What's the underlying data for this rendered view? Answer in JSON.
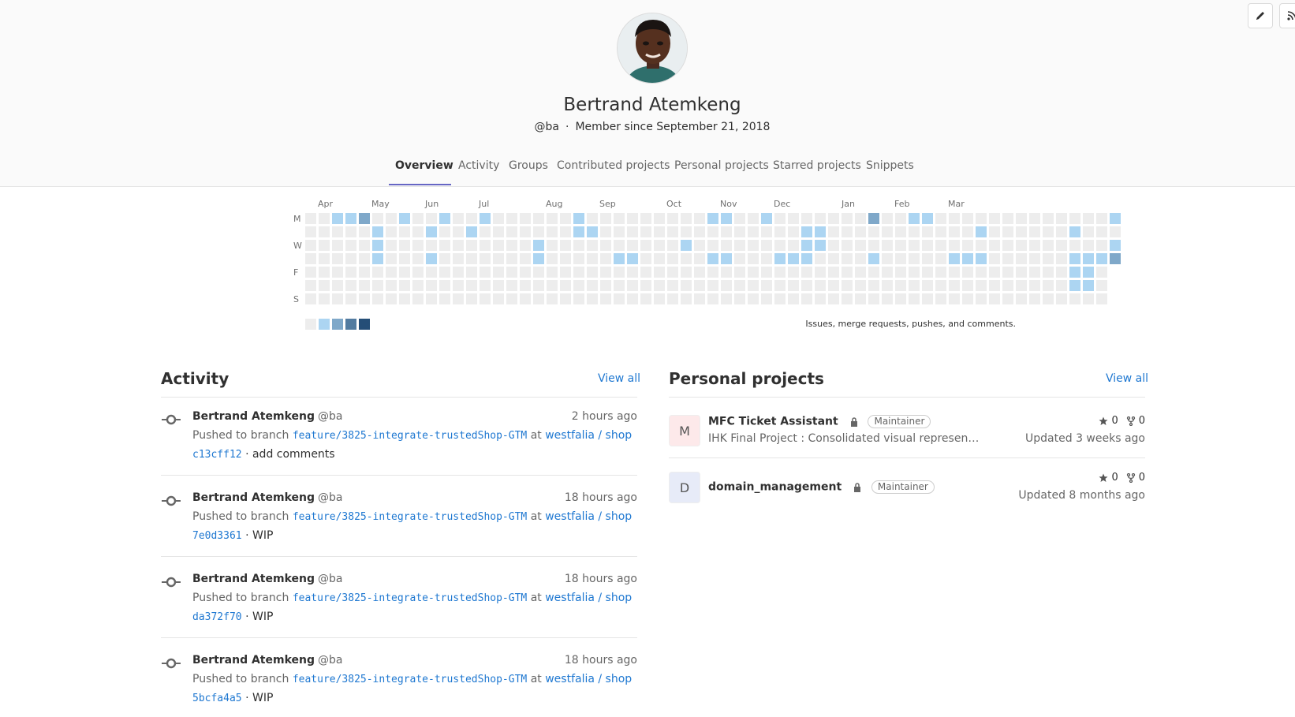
{
  "header": {
    "edit_icon": "pencil-icon",
    "rss_icon": "rss-icon",
    "name": "Bertrand Atemkeng",
    "handle": "@ba",
    "separator": "·",
    "member_since": "Member since September 21, 2018"
  },
  "tabs": [
    {
      "label": "Overview",
      "active": true
    },
    {
      "label": "Activity",
      "active": false
    },
    {
      "label": "Groups",
      "active": false
    },
    {
      "label": "Contributed projects",
      "active": false
    },
    {
      "label": "Personal projects",
      "active": false
    },
    {
      "label": "Starred projects",
      "active": false
    },
    {
      "label": "Snippets",
      "active": false
    }
  ],
  "calendar": {
    "months": [
      "Apr",
      "May",
      "Jun",
      "Jul",
      "Aug",
      "Sep",
      "Oct",
      "Nov",
      "Dec",
      "Jan",
      "Feb",
      "Mar"
    ],
    "days": [
      "M",
      "W",
      "F",
      "S"
    ],
    "caption": "Issues, merge requests, pushes, and comments.",
    "colors": [
      "#ededed",
      "#acd5f2",
      "#7fa8c9",
      "#527ba0",
      "#254e77"
    ],
    "levels": [
      "0011200100100100000010000000001100100000002001100000000000001",
      "0000010001001000000011000000000000000110000000000010000001000",
      "0000010000000000010000000000100000000110000000000000000000001",
      "0000010001000000010000011000001100011100001000001110000001112",
      "0000000000000000000000000000000000000000000000000000000001102",
      "0000000000000000000000000000000000000000000000000000000001102",
      "0000000000000000000000000000000000000000000000000000000000000"
    ]
  },
  "activity": {
    "title": "Activity",
    "view_all": "View all",
    "events": [
      {
        "author": "Bertrand Atemkeng",
        "handle": "@ba",
        "time": "2 hours ago",
        "action": "Pushed to branch",
        "branch": "feature/3825-integrate-trustedShop-GTM",
        "at": "at",
        "project": "westfalia / shop",
        "commit": "c13cff12",
        "message": "· add comments"
      },
      {
        "author": "Bertrand Atemkeng",
        "handle": "@ba",
        "time": "18 hours ago",
        "action": "Pushed to branch",
        "branch": "feature/3825-integrate-trustedShop-GTM",
        "at": "at",
        "project": "westfalia / shop",
        "commit": "7e0d3361",
        "message": "· WIP"
      },
      {
        "author": "Bertrand Atemkeng",
        "handle": "@ba",
        "time": "18 hours ago",
        "action": "Pushed to branch",
        "branch": "feature/3825-integrate-trustedShop-GTM",
        "at": "at",
        "project": "westfalia / shop",
        "commit": "da372f70",
        "message": "· WIP"
      },
      {
        "author": "Bertrand Atemkeng",
        "handle": "@ba",
        "time": "18 hours ago",
        "action": "Pushed to branch",
        "branch": "feature/3825-integrate-trustedShop-GTM",
        "at": "at",
        "project": "westfalia / shop",
        "commit": "5bcfa4a5",
        "message": "· WIP"
      }
    ]
  },
  "personal_projects": {
    "title": "Personal projects",
    "view_all": "View all",
    "projects": [
      {
        "initial": "M",
        "name": "MFC Ticket Assistant",
        "role": "Maintainer",
        "description": "IHK Final Project : Consolidated visual represen…",
        "stars": "0",
        "forks": "0",
        "updated": "Updated 3 weeks ago",
        "avatar_color": "#fde9ea"
      },
      {
        "initial": "D",
        "name": "domain_management",
        "role": "Maintainer",
        "description": "",
        "stars": "0",
        "forks": "0",
        "updated": "Updated 8 months ago",
        "avatar_color": "#e7ebf8"
      }
    ]
  }
}
